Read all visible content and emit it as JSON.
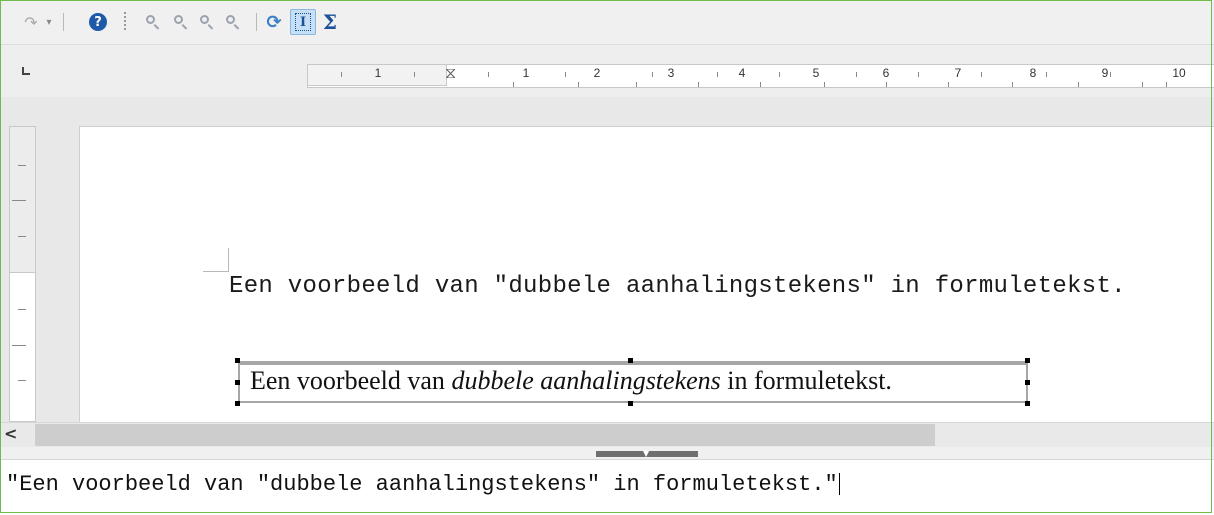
{
  "toolbar": {
    "help_glyph": "?",
    "sigma_glyph": "Σ",
    "formula_cursor_glyph": "I",
    "refresh_glyph": "⟳",
    "redo_glyph": "↷",
    "dropdown_glyph": "▾"
  },
  "ruler": {
    "labels": [
      "1",
      "1",
      "2",
      "3",
      "4",
      "5",
      "6",
      "7",
      "8",
      "9",
      "10"
    ]
  },
  "document": {
    "line1": "Een voorbeeld van \"dubbele aanhalingstekens\" in formuletekst.",
    "formula": {
      "plain1": "Een voorbeeld van ",
      "italic": "dubbele aanhalingstekens",
      "plain2": " in formuletekst."
    }
  },
  "scrollbar": {
    "left_arrow": "<"
  },
  "splitter": {
    "arrow": "▼"
  },
  "command_input": {
    "value": "\"Een voorbeeld van \"dubbele aanhalingstekens\" in formuletekst.\""
  }
}
